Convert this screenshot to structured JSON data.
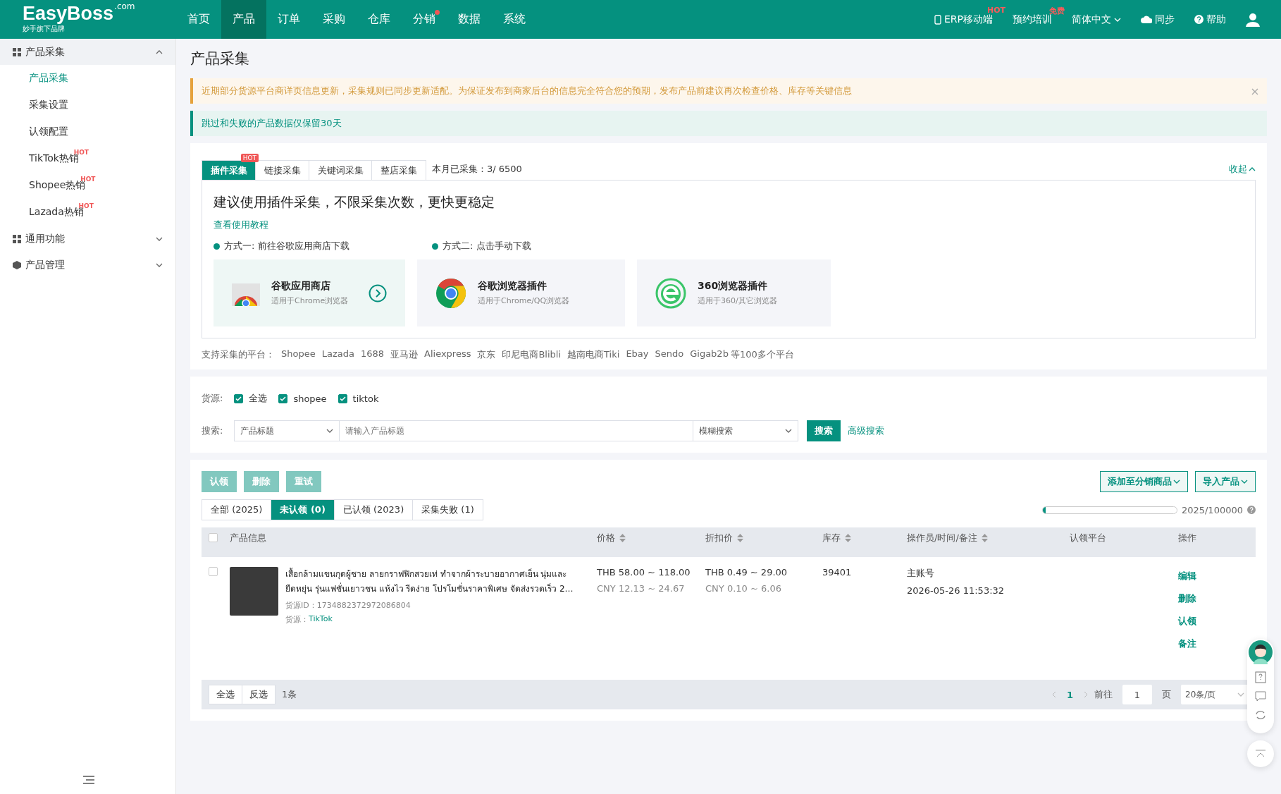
{
  "header": {
    "logo": {
      "text": "EasyBoss",
      "suffix": ".com",
      "tagline": "妙手旗下品牌"
    },
    "nav": [
      {
        "label": "首页",
        "selected": false,
        "dot": false
      },
      {
        "label": "产品",
        "selected": true,
        "dot": false
      },
      {
        "label": "订单",
        "selected": false,
        "dot": false
      },
      {
        "label": "采购",
        "selected": false,
        "dot": false
      },
      {
        "label": "仓库",
        "selected": false,
        "dot": false
      },
      {
        "label": "分销",
        "selected": false,
        "dot": true
      },
      {
        "label": "数据",
        "selected": false,
        "dot": false
      },
      {
        "label": "系统",
        "selected": false,
        "dot": false
      }
    ],
    "tools": [
      {
        "kind": "mobile",
        "label": "ERP移动端",
        "badge": "HOT"
      },
      {
        "kind": "plain",
        "label": "预约培训",
        "badge": "免费"
      },
      {
        "kind": "dropdown",
        "label": "简体中文"
      },
      {
        "kind": "sync",
        "label": "同步"
      },
      {
        "kind": "help",
        "label": "帮助"
      }
    ]
  },
  "sidebar": {
    "groups": [
      {
        "label": "产品采集",
        "expanded": true,
        "children": [
          {
            "label": "产品采集",
            "selected": true
          },
          {
            "label": "采集设置",
            "selected": false
          },
          {
            "label": "认领配置",
            "selected": false
          },
          {
            "label": "TikTok热销",
            "selected": false,
            "badge": "HOT"
          },
          {
            "label": "Shopee热销",
            "selected": false,
            "badge": "HOT"
          },
          {
            "label": "Lazada热销",
            "selected": false,
            "badge": "HOT"
          }
        ]
      },
      {
        "label": "通用功能",
        "expanded": false
      },
      {
        "label": "产品管理",
        "expanded": false
      }
    ]
  },
  "page_title": "产品采集",
  "notices": [
    {
      "kind": "warning",
      "text": "近期部分货源平台商详页信息更新，采集规则已同步更新适配。为保证发布到商家后台的信息完全符合您的预期，发布产品前建议再次检查价格、库存等关键信息",
      "closable": true
    },
    {
      "kind": "info",
      "text": "跳过和失败的产品数据仅保留30天",
      "closable": false
    }
  ],
  "collect": {
    "tabs": [
      {
        "label": "插件采集",
        "selected": true,
        "badge": "HOT"
      },
      {
        "label": "链接采集",
        "selected": false
      },
      {
        "label": "关键词采集",
        "selected": false
      },
      {
        "label": "整店采集",
        "selected": false
      }
    ],
    "quota": "本月已采集：3/ 6500",
    "collapse": "收起",
    "headline": "建议使用插件采集，不限采集次数，更快更稳定",
    "tutorial_link": "查看使用教程",
    "methods": [
      "方式一: 前往谷歌应用商店下载",
      "方式二: 点击手动下载"
    ],
    "cards": [
      {
        "kind": "store",
        "title": "谷歌应用商店",
        "subtitle": "适用于Chrome浏览器",
        "selected": true
      },
      {
        "kind": "chrome",
        "title": "谷歌浏览器插件",
        "subtitle": "适用于Chrome/QQ浏览器",
        "selected": false
      },
      {
        "kind": "browser360",
        "title": "360浏览器插件",
        "subtitle": "适用于360/其它浏览器",
        "selected": false
      }
    ],
    "platforms_label": "支持采集的平台：",
    "platforms": [
      "Shopee",
      "Lazada",
      "1688",
      "亚马逊",
      "Aliexpress",
      "京东",
      "印尼电商Blibli",
      "越南电商Tiki",
      "Ebay",
      "Sendo",
      "Gigab2b"
    ],
    "platforms_suffix": "等100多个平台"
  },
  "filter": {
    "source_label": "货源:",
    "sources": [
      {
        "label": "全选",
        "checked": true
      },
      {
        "label": "shopee",
        "checked": true
      },
      {
        "label": "tiktok",
        "checked": true
      }
    ],
    "search_label": "搜索:",
    "field": "产品标题",
    "placeholder": "请输入产品标题",
    "mode": "模糊搜索",
    "search_button": "搜索",
    "advanced": "高级搜索"
  },
  "list": {
    "actions": [
      {
        "label": "认领",
        "disabled": true
      },
      {
        "label": "删除",
        "disabled": true
      },
      {
        "label": "重试",
        "disabled": true
      }
    ],
    "right_actions": [
      "添加至分销商品",
      "导入产品"
    ],
    "status_tabs": [
      {
        "label": "全部 (2025)",
        "selected": false
      },
      {
        "label": "未认领 (0)",
        "selected": true
      },
      {
        "label": "已认领 (2023)",
        "selected": false
      },
      {
        "label": "采集失败 (1)",
        "selected": false
      }
    ],
    "usage": {
      "level": 0.02,
      "reading": "2025/100000"
    },
    "header_checked": false,
    "columns": [
      {
        "label": "产品信息",
        "sortable": false
      },
      {
        "label": "价格",
        "sortable": true
      },
      {
        "label": "折扣价",
        "sortable": true
      },
      {
        "label": "库存",
        "sortable": true
      },
      {
        "label": "操作员/时间/备注",
        "sortable": true
      },
      {
        "label": "认领平台",
        "sortable": false
      },
      {
        "label": "操作",
        "sortable": false
      }
    ],
    "rows": [
      {
        "checked": false,
        "title": "เสื้อกล้ามแขนกุดผู้ชาย ลายกราฟฟิกสวยเท่ ทำจากผ้าระบายอากาศเย็น นุ่มและยืดหยุ่น รุ่นแฟชั่นเยาวชน แห้งไว รีดง่าย โปรโมชั่นราคาพิเศษ จัดส่งรวดเร็ว 2…",
        "source_id": "货源ID：1734882372972086804",
        "source_label": "货源：",
        "source": "TikTok",
        "price": [
          "THB 58.00 ~ 118.00",
          "CNY 12.13 ~ 24.67"
        ],
        "discount": [
          "THB 0.49 ~ 29.00",
          "CNY 0.10 ~ 6.06"
        ],
        "stock": "39401",
        "operator": "主账号",
        "time": "2026-05-26 11:53:32",
        "actions": [
          "编辑",
          "删除",
          "认领",
          "备注"
        ]
      }
    ],
    "footer": {
      "select_all": "全选",
      "invert": "反选",
      "count": "1条",
      "pages": [
        {
          "label": "1",
          "selected": true
        }
      ],
      "goto": "前往",
      "page_input": "1",
      "page_unit": "页",
      "page_size": "20条/页"
    }
  }
}
